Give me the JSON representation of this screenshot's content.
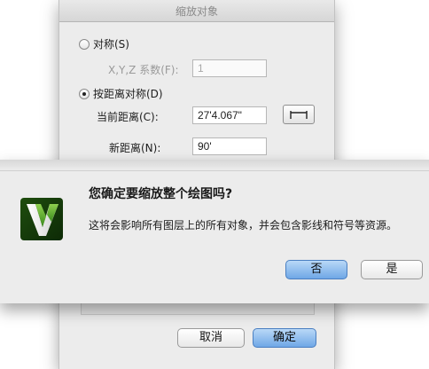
{
  "background_dialog": {
    "title": "缩放对象",
    "symmetric_option": {
      "label": "对称(S)",
      "checked": false
    },
    "factor_label": "X,Y,Z 系数(F):",
    "factor_value": "1",
    "distance_option": {
      "label": "按距离对称(D)",
      "checked": true
    },
    "current_distance_label": "当前距离(C):",
    "current_distance_value": "27'4.067\"",
    "new_distance_label": "新距离(N):",
    "new_distance_value": "90'",
    "cancel_label": "取消",
    "ok_label": "确定"
  },
  "alert": {
    "title": "您确定要缩放整个绘图吗?",
    "message": "这将会影响所有图层上的所有对象，并会包含影线和符号等资源。",
    "no_label": "否",
    "yes_label": "是"
  },
  "icons": {
    "app_icon": "vectorworks-logo-icon",
    "measure_icon": "measure-distance-icon"
  },
  "colors": {
    "default_button": "#6fa7e6",
    "logo_green": "#3a8a1c"
  }
}
